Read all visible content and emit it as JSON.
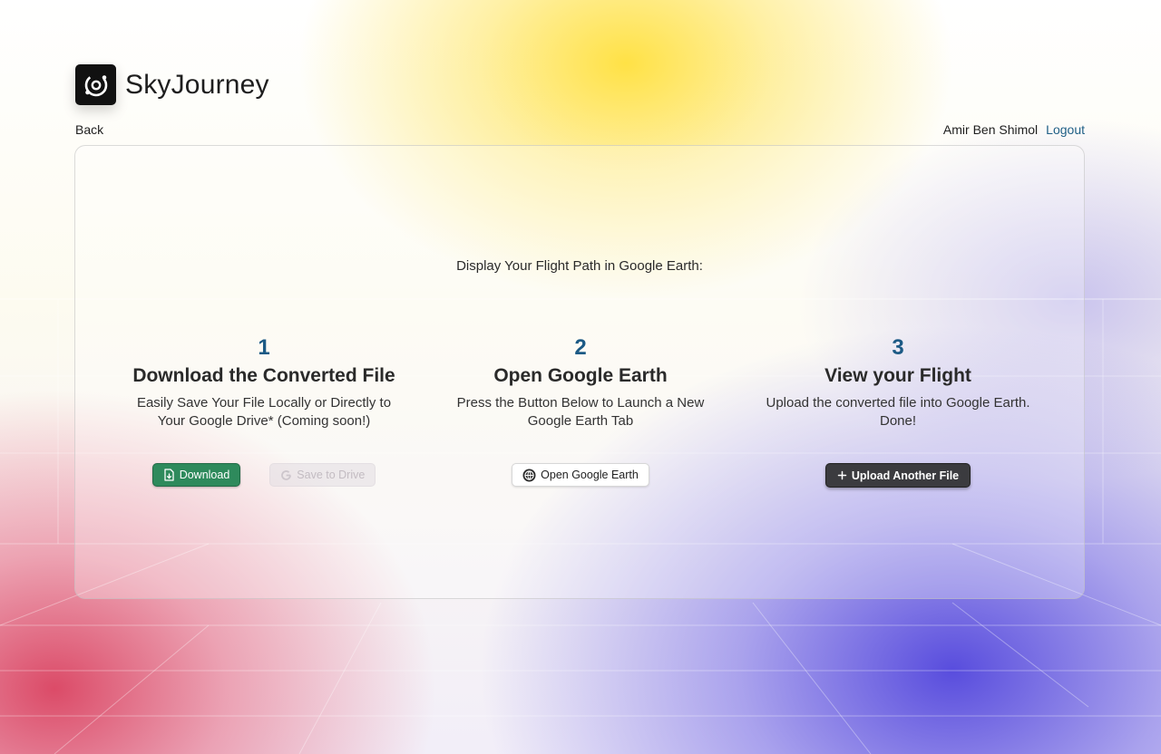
{
  "app": {
    "title": "SkyJourney",
    "logo_icon": "orbit-logo-icon"
  },
  "nav": {
    "back_label": "Back"
  },
  "user": {
    "name": "Amir Ben Shimol",
    "logout_label": "Logout"
  },
  "main": {
    "instruction": "Display Your Flight Path in Google Earth:",
    "steps": [
      {
        "number": "1",
        "title": "Download the Converted File",
        "description": "Easily Save Your File Locally or Directly to Your Google Drive* (Coming soon!)",
        "buttons": [
          {
            "label": "Download",
            "icon": "file-download-icon"
          },
          {
            "label": "Save to Drive",
            "icon": "google-icon"
          }
        ]
      },
      {
        "number": "2",
        "title": "Open Google Earth",
        "description": "Press the Button Below to Launch a New Google Earth Tab",
        "buttons": [
          {
            "label": "Open Google Earth",
            "icon": "google-earth-icon"
          }
        ]
      },
      {
        "number": "3",
        "title": "View your Flight",
        "description": "Upload the converted file into Google Earth. Done!",
        "buttons": [
          {
            "label": "Upload Another File",
            "icon": "plus-icon"
          }
        ]
      }
    ]
  },
  "colors": {
    "accent_number": "#1c5a85",
    "download_green": "#2e8a5c",
    "upload_dark": "#3b3b3f",
    "logout_link": "#1f5f86"
  }
}
